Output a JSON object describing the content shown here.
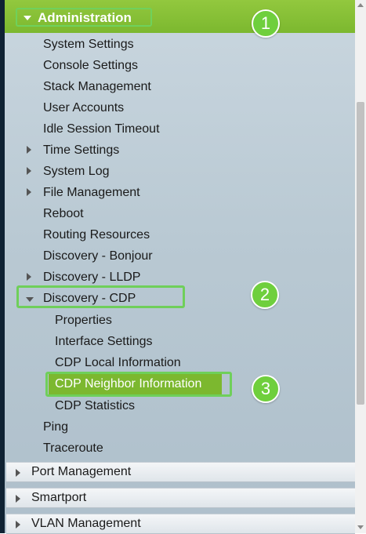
{
  "header": {
    "title": "Administration"
  },
  "menu": {
    "items": [
      "System Settings",
      "Console Settings",
      "Stack Management",
      "User Accounts",
      "Idle Session Timeout",
      "Time Settings",
      "System Log",
      "File Management",
      "Reboot",
      "Routing Resources",
      "Discovery - Bonjour",
      "Discovery - LLDP",
      "Discovery - CDP"
    ],
    "cdp_sub": [
      "Properties",
      "Interface Settings",
      "CDP Local Information",
      "CDP Neighbor Information",
      "CDP Statistics"
    ],
    "tail": [
      "Ping",
      "Traceroute"
    ]
  },
  "sections": [
    "Port Management",
    "Smartport",
    "VLAN Management"
  ],
  "badges": [
    "1",
    "2",
    "3"
  ],
  "colors": {
    "accent": "#7cb82f",
    "highlight_border": "#6fcf5a",
    "sidebar_dark": "#0f2233"
  }
}
